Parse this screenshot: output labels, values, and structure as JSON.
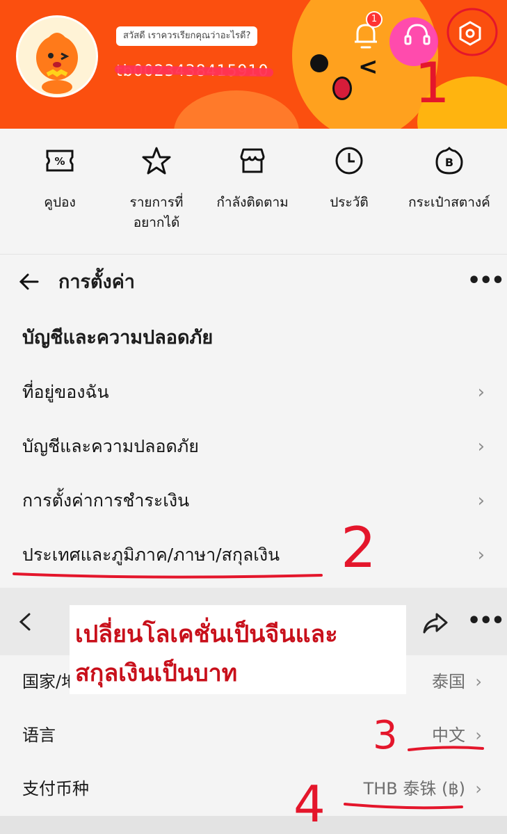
{
  "header": {
    "greeting": "สวัสดี เราควรเรียกคุณว่าอะไรดี?",
    "user_id": "tb0023438415910",
    "notification_count": "1",
    "colors": {
      "header_bg": "#fb4f0f",
      "annotation": "#e4162b"
    }
  },
  "quick_links": [
    {
      "label": "คูปอง",
      "icon": "coupon-icon"
    },
    {
      "label": "รายการที่\nอยากได้",
      "icon": "star-icon"
    },
    {
      "label": "กำลังติดตาม",
      "icon": "store-icon"
    },
    {
      "label": "ประวัติ",
      "icon": "clock-icon"
    },
    {
      "label": "กระเป๋าสตางค์",
      "icon": "wallet-icon"
    }
  ],
  "settings": {
    "title": "การตั้งค่า",
    "section_header": "บัญชีและความปลอดภัย",
    "items": [
      {
        "label": "ที่อยู่ของฉัน"
      },
      {
        "label": "บัญชีและความปลอดภัย"
      },
      {
        "label": "การตั้งค่าการชำระเงิน"
      },
      {
        "label": "ประเทศและภูมิภาค/ภาษา/สกุลเงิน"
      }
    ]
  },
  "language_page": {
    "rows": [
      {
        "label": "国家/地",
        "value": "泰国"
      },
      {
        "label": "语言",
        "value": "中文"
      },
      {
        "label": "支付币种",
        "value": "THB 泰铢 (฿)"
      }
    ]
  },
  "annotations": {
    "note_line1": "เปลี่ยนโลเคชั่นเป็นจีนและ",
    "note_line2": "สกุลเงินเป็นบาท",
    "n1": "1",
    "n2": "2",
    "n3": "3",
    "n4": "4"
  }
}
